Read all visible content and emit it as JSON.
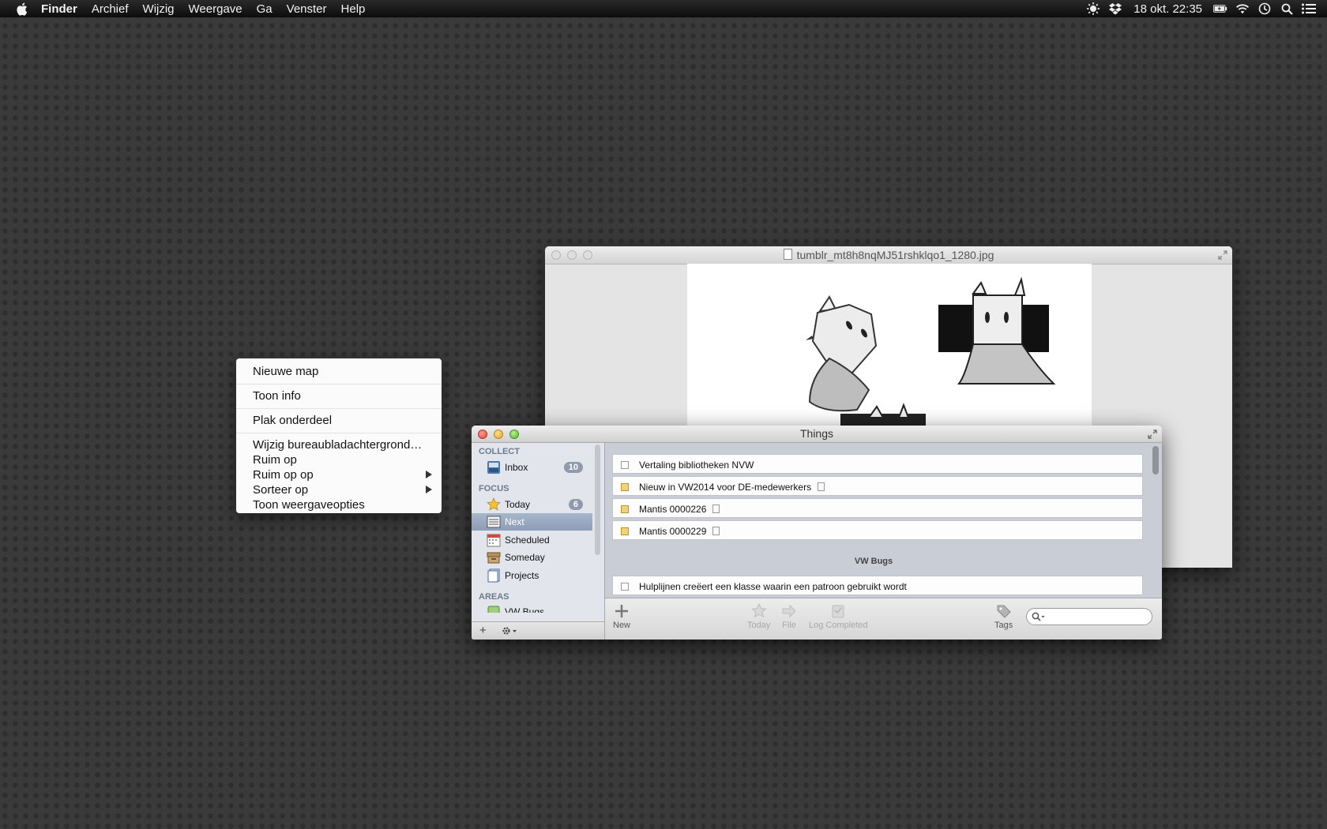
{
  "menubar": {
    "apple_icon": "apple-icon",
    "items": [
      "Finder",
      "Archief",
      "Wijzig",
      "Weergave",
      "Ga",
      "Venster",
      "Help"
    ],
    "clock": "18 okt.  22:35",
    "status_icons": [
      "brightness-icon",
      "dropbox-icon",
      "battery-icon",
      "wifi-icon",
      "time-machine-icon",
      "spotlight-icon",
      "notification-center-icon"
    ]
  },
  "context_menu": {
    "items": [
      {
        "label": "Nieuwe map"
      },
      {
        "label": "Toon info"
      },
      {
        "label": "Plak onderdeel"
      },
      {
        "label": "Wijzig bureaubladachtergrond…"
      },
      {
        "label": "Ruim op"
      },
      {
        "label": "Ruim op op",
        "submenu": true
      },
      {
        "label": "Sorteer op",
        "submenu": true
      },
      {
        "label": "Toon weergaveopties"
      }
    ]
  },
  "preview": {
    "title": "tumblr_mt8h8nqMJ51rshklqo1_1280.jpg"
  },
  "things": {
    "title": "Things",
    "sidebar": {
      "collect_label": "COLLECT",
      "focus_label": "FOCUS",
      "areas_label": "AREAS",
      "inbox": {
        "label": "Inbox",
        "count": "10"
      },
      "today": {
        "label": "Today",
        "count": "6"
      },
      "next": {
        "label": "Next"
      },
      "scheduled": {
        "label": "Scheduled"
      },
      "someday": {
        "label": "Someday"
      },
      "projects": {
        "label": "Projects"
      },
      "area_partial": "VW Bugs"
    },
    "tasks": [
      {
        "title": "Vertaling bibliotheken NVW",
        "note": false,
        "project": false
      },
      {
        "title": "Nieuw in VW2014 voor DE-medewerkers",
        "note": true,
        "project": true
      },
      {
        "title": "Mantis 0000226",
        "note": true,
        "project": true
      },
      {
        "title": "Mantis 0000229",
        "note": true,
        "project": true
      }
    ],
    "group_title": "VW Bugs",
    "group_tasks": [
      {
        "title": "Hulplijnen creëert een klasse waarin een patroon gebruikt wordt"
      }
    ],
    "toolbar": {
      "new": "New",
      "today": "Today",
      "file": "File",
      "log_completed": "Log Completed",
      "tags": "Tags"
    },
    "search_placeholder": ""
  }
}
